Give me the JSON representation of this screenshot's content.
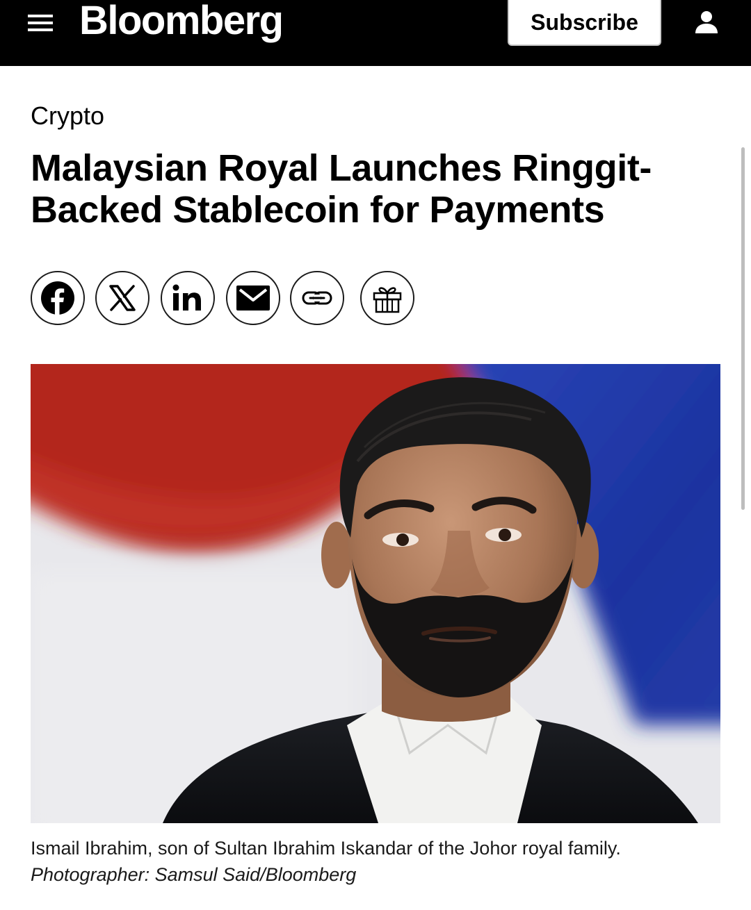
{
  "header": {
    "logo": "Bloomberg",
    "subscribe_label": "Subscribe",
    "menu_icon": "hamburger-menu-icon",
    "account_icon": "user-icon",
    "background_color": "#000000"
  },
  "article": {
    "category": "Crypto",
    "headline": "Malaysian Royal Launches Ringgit-Backed Stablecoin for Payments",
    "share_icons": [
      "facebook-icon",
      "x-icon",
      "linkedin-icon",
      "email-icon",
      "link-icon",
      "gift-icon"
    ],
    "caption": {
      "text": "Ismail Ibrahim, son of Sultan Ibrahim Iskandar of the Johor royal family.",
      "credit": "Photographer: Samsul Said/Bloomberg"
    }
  },
  "colors": {
    "flag_red": "#b3261e",
    "flag_blue": "#1d3aa8",
    "text": "#000000"
  }
}
